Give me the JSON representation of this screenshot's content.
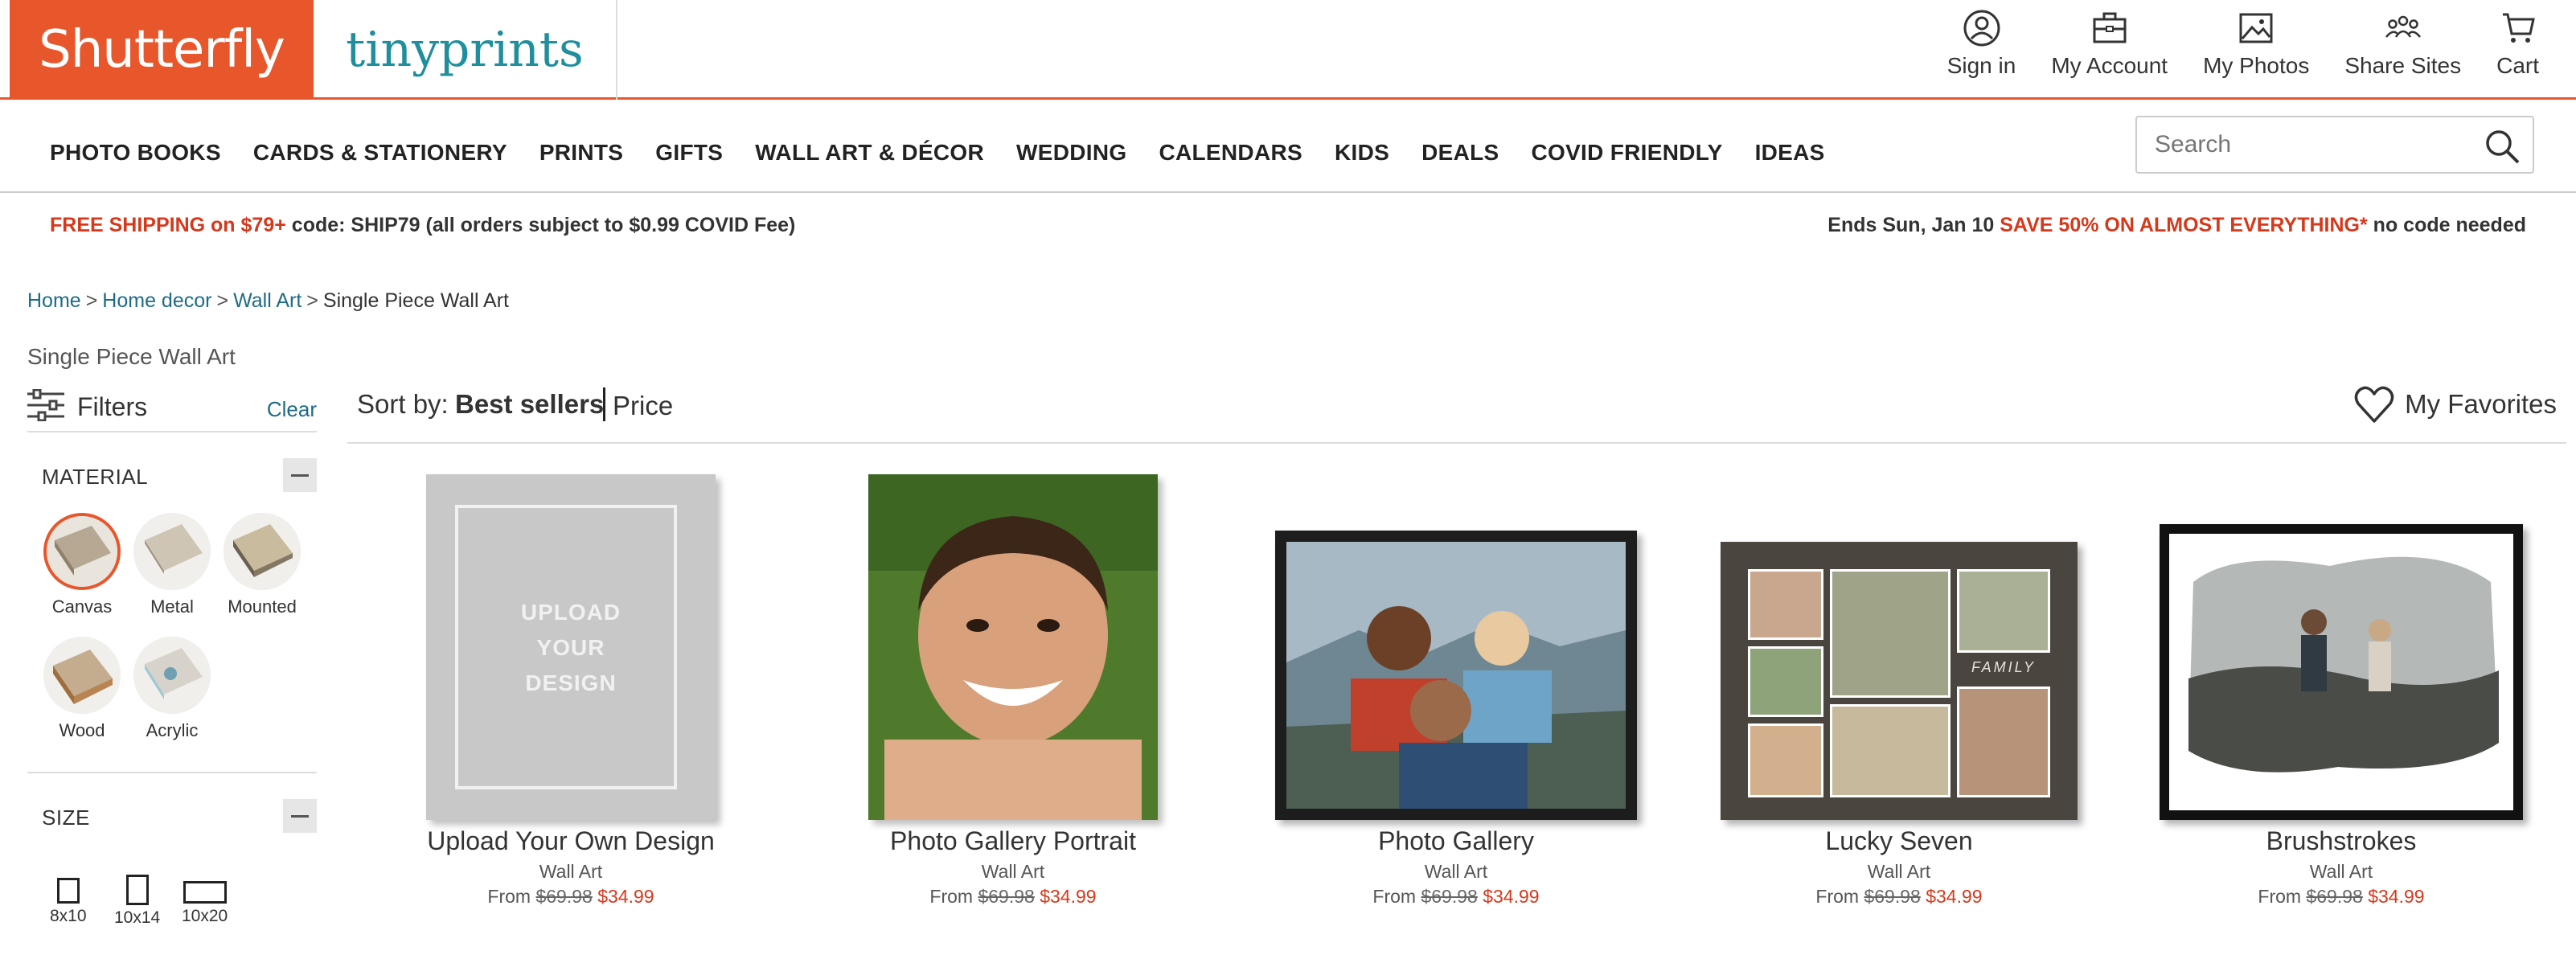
{
  "brand": {
    "primary": "Shutterfly",
    "secondary": "tinyprints",
    "accent": "#e8562c",
    "link": "#1d6b86",
    "sale": "#d5391b"
  },
  "account_nav": [
    {
      "label": "Sign in",
      "icon": "user-icon"
    },
    {
      "label": "My Account",
      "icon": "briefcase-icon"
    },
    {
      "label": "My Photos",
      "icon": "photo-icon"
    },
    {
      "label": "Share Sites",
      "icon": "group-icon"
    },
    {
      "label": "Cart",
      "icon": "cart-icon"
    }
  ],
  "categories": [
    "PHOTO BOOKS",
    "CARDS & STATIONERY",
    "PRINTS",
    "GIFTS",
    "WALL ART & DÉCOR",
    "WEDDING",
    "CALENDARS",
    "KIDS",
    "DEALS",
    "COVID FRIENDLY",
    "IDEAS"
  ],
  "search": {
    "placeholder": "Search"
  },
  "promo": {
    "left_highlight": "FREE SHIPPING on $79+",
    "left_rest": " code: SHIP79 (all orders subject to $0.99 COVID Fee)",
    "right_prefix": "Ends Sun, Jan 10 ",
    "right_highlight": "SAVE 50% ON ALMOST EVERYTHING*",
    "right_suffix": " no code needed"
  },
  "breadcrumb": {
    "home": "Home",
    "home_decor": "Home decor",
    "wall_art": "Wall Art",
    "current": "Single Piece Wall Art",
    "sep": ">"
  },
  "page_title": "Single Piece Wall Art",
  "filters": {
    "label": "Filters",
    "clear": "Clear",
    "material": {
      "label": "MATERIAL",
      "options": [
        "Canvas",
        "Metal",
        "Mounted",
        "Wood",
        "Acrylic"
      ],
      "selected": "Canvas"
    },
    "size": {
      "label": "SIZE",
      "options": [
        "8x10",
        "10x14",
        "10x20"
      ]
    }
  },
  "sort": {
    "label": "Sort by:",
    "best": "Best sellers",
    "price": "Price"
  },
  "favorites": {
    "label": "My Favorites"
  },
  "products": [
    {
      "name": "Upload Your Own Design",
      "type": "Wall Art",
      "from": "From",
      "orig": "$69.98",
      "sale": "$34.99",
      "upload_text": [
        "UPLOAD",
        "YOUR",
        "DESIGN"
      ]
    },
    {
      "name": "Photo Gallery Portrait",
      "type": "Wall Art",
      "from": "From",
      "orig": "$69.98",
      "sale": "$34.99"
    },
    {
      "name": "Photo Gallery",
      "type": "Wall Art",
      "from": "From",
      "orig": "$69.98",
      "sale": "$34.99"
    },
    {
      "name": "Lucky Seven",
      "type": "Wall Art",
      "from": "From",
      "orig": "$69.98",
      "sale": "$34.99",
      "overlay": "FAMILY"
    },
    {
      "name": "Brushstrokes",
      "type": "Wall Art",
      "from": "From",
      "orig": "$69.98",
      "sale": "$34.99"
    }
  ]
}
